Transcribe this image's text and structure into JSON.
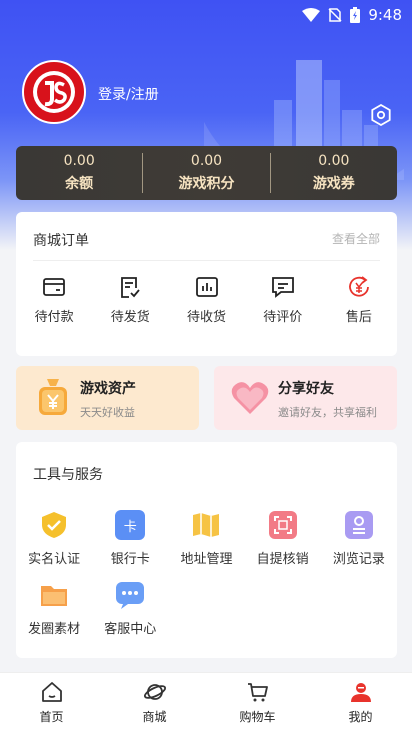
{
  "status_bar": {
    "time": "9:48"
  },
  "profile": {
    "login_label": "登录/注册"
  },
  "stats": [
    {
      "value": "0.00",
      "label": "余额"
    },
    {
      "value": "0.00",
      "label": "游戏积分"
    },
    {
      "value": "0.00",
      "label": "游戏券"
    }
  ],
  "orders": {
    "title": "商城订单",
    "view_all": "查看全部",
    "items": [
      {
        "label": "待付款",
        "icon": "wallet-icon"
      },
      {
        "label": "待发货",
        "icon": "clipboard-check-icon"
      },
      {
        "label": "待收货",
        "icon": "box-chart-icon"
      },
      {
        "label": "待评价",
        "icon": "comment-icon"
      },
      {
        "label": "售后",
        "icon": "refund-icon"
      }
    ]
  },
  "promos": {
    "assets": {
      "title": "游戏资产",
      "subtitle": "天天好收益"
    },
    "share": {
      "title": "分享好友",
      "subtitle": "邀请好友，共享福利"
    }
  },
  "tools": {
    "title": "工具与服务",
    "items": [
      {
        "label": "实名认证",
        "icon": "shield-icon"
      },
      {
        "label": "银行卡",
        "icon": "card-icon",
        "glyph": "卡"
      },
      {
        "label": "地址管理",
        "icon": "map-icon"
      },
      {
        "label": "自提核销",
        "icon": "scan-icon"
      },
      {
        "label": "浏览记录",
        "icon": "history-icon"
      },
      {
        "label": "发圈素材",
        "icon": "folder-icon"
      },
      {
        "label": "客服中心",
        "icon": "chat-icon"
      }
    ]
  },
  "tabbar": [
    {
      "label": "首页",
      "icon": "home-icon"
    },
    {
      "label": "商城",
      "icon": "planet-icon"
    },
    {
      "label": "购物车",
      "icon": "cart-icon"
    },
    {
      "label": "我的",
      "icon": "user-icon"
    }
  ],
  "colors": {
    "primary": "#3f52f3",
    "accent_red": "#e8332c",
    "gold_text": "#f6e3c1"
  }
}
